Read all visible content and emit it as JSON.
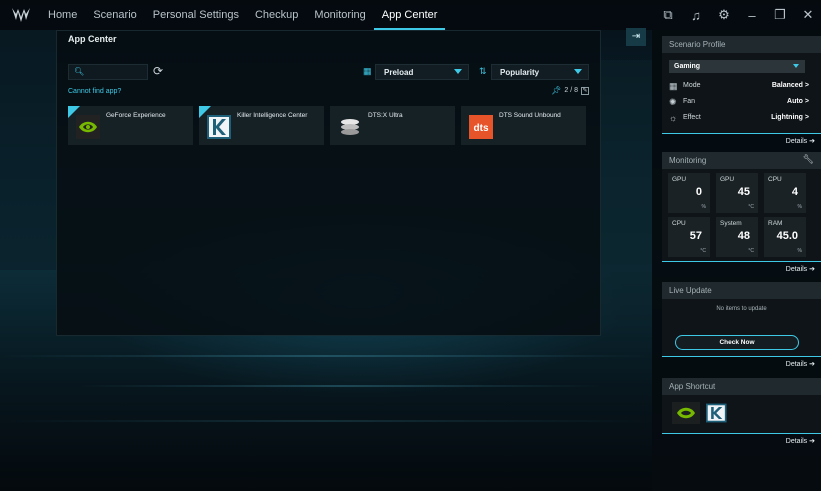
{
  "nav": {
    "tabs": [
      "Home",
      "Scenario",
      "Personal Settings",
      "Checkup",
      "Monitoring",
      "App Center"
    ],
    "active_index": 5,
    "window_controls": [
      "scene-icon",
      "headset-icon",
      "gear-icon",
      "minimize-icon",
      "restore-icon",
      "close-icon"
    ]
  },
  "app_center": {
    "title": "App Center",
    "search": {
      "placeholder": "",
      "value": ""
    },
    "filter": {
      "selected": "Preload"
    },
    "sort": {
      "selected": "Popularity"
    },
    "cannot_find_link": "Cannot find app?",
    "pin_count": "2 / 8",
    "apps": [
      {
        "name": "GeForce Experience",
        "pinned": true,
        "icon": "nvidia-icon"
      },
      {
        "name": "Killer Intelligence Center",
        "pinned": true,
        "icon": "killer-icon"
      },
      {
        "name": "DTS:X Ultra",
        "pinned": false,
        "icon": "dtsx-icon"
      },
      {
        "name": "DTS Sound Unbound",
        "pinned": false,
        "icon": "dts-icon"
      }
    ]
  },
  "sidebar": {
    "scenario_profile": {
      "title": "Scenario Profile",
      "profile": "Gaming",
      "rows": [
        {
          "label": "Mode",
          "value": "Balanced >",
          "icon": "mode-icon"
        },
        {
          "label": "Fan",
          "value": "Auto >",
          "icon": "fan-icon"
        },
        {
          "label": "Effect",
          "value": "Lightning >",
          "icon": "effect-icon"
        }
      ],
      "details": "Details ➔"
    },
    "monitoring": {
      "title": "Monitoring",
      "tiles": [
        {
          "label": "GPU",
          "value": "0",
          "unit": "%"
        },
        {
          "label": "GPU",
          "value": "45",
          "unit": "°C"
        },
        {
          "label": "CPU",
          "value": "4",
          "unit": "%"
        },
        {
          "label": "CPU",
          "value": "57",
          "unit": "°C"
        },
        {
          "label": "System",
          "value": "48",
          "unit": "°C"
        },
        {
          "label": "RAM",
          "value": "45.0",
          "unit": "%"
        }
      ],
      "details": "Details ➔"
    },
    "live_update": {
      "title": "Live Update",
      "message": "No items to update",
      "button": "Check Now",
      "details": "Details ➔"
    },
    "app_shortcut": {
      "title": "App Shortcut",
      "icons": [
        "nvidia-icon",
        "killer-icon"
      ],
      "details": "Details ➔"
    }
  },
  "colors": {
    "accent": "#3ec9e6",
    "panel": "#0f1418",
    "card": "#162126"
  }
}
